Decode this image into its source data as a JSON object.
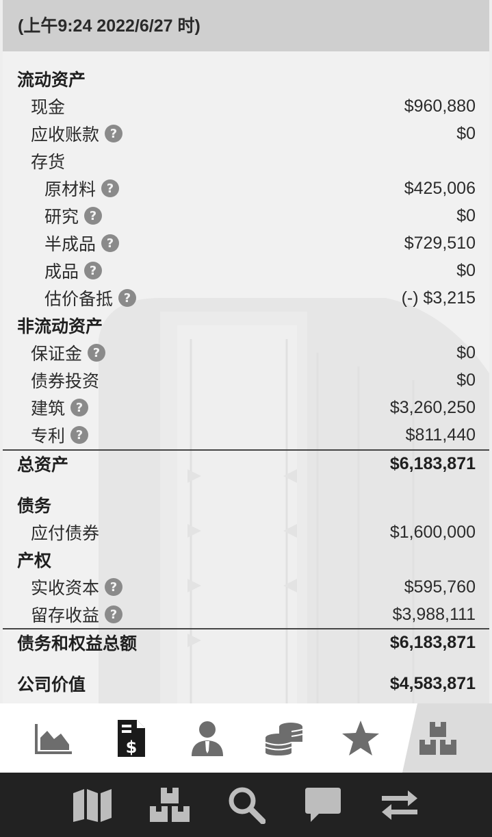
{
  "header": {
    "subtitle": "(上午9:24 2022/6/27 时)"
  },
  "help_glyph": "?",
  "rows": [
    {
      "label": "流动资产",
      "value": ""
    },
    {
      "label": "现金",
      "value": "$960,880"
    },
    {
      "label": "应收账款",
      "value": "$0"
    },
    {
      "label": "存货",
      "value": ""
    },
    {
      "label": "原材料",
      "value": "$425,006"
    },
    {
      "label": "研究",
      "value": "$0"
    },
    {
      "label": "半成品",
      "value": "$729,510"
    },
    {
      "label": "成品",
      "value": "$0"
    },
    {
      "label": "估价备抵",
      "value": "(-) $3,215"
    },
    {
      "label": "非流动资产",
      "value": ""
    },
    {
      "label": "保证金",
      "value": "$0"
    },
    {
      "label": "债券投资",
      "value": "$0"
    },
    {
      "label": "建筑",
      "value": "$3,260,250"
    },
    {
      "label": "专利",
      "value": "$811,440"
    },
    {
      "label": "总资产",
      "value": "$6,183,871"
    },
    {
      "label": "债务",
      "value": ""
    },
    {
      "label": "应付债券",
      "value": "$1,600,000"
    },
    {
      "label": "产权",
      "value": ""
    },
    {
      "label": "实收资本",
      "value": "$595,760"
    },
    {
      "label": "留存收益",
      "value": "$3,988,111"
    },
    {
      "label": "债务和权益总额",
      "value": "$6,183,871"
    },
    {
      "label": "公司价值",
      "value": "$4,583,871"
    }
  ],
  "tabs": [
    {
      "icon": "area-chart-icon"
    },
    {
      "icon": "invoice-dollar-icon"
    },
    {
      "icon": "businessman-icon"
    },
    {
      "icon": "coins-stack-icon"
    },
    {
      "icon": "star-icon"
    },
    {
      "icon": "boxes-icon",
      "active": true
    }
  ],
  "nav": [
    {
      "icon": "map-icon"
    },
    {
      "icon": "boxes-icon"
    },
    {
      "icon": "search-icon"
    },
    {
      "icon": "chat-icon"
    },
    {
      "icon": "swap-icon"
    }
  ],
  "colors": {
    "header_bg": "#cfcfcf",
    "sheet_bg": "#f1f1f1",
    "tab_icon": "#6d6d6d",
    "tab_icon_active": "#1a1a1a",
    "navbar_bg": "#222222",
    "nav_icon": "#bdbdbd"
  }
}
